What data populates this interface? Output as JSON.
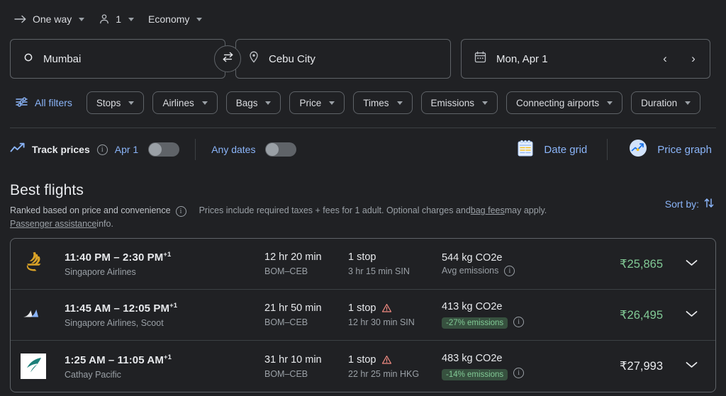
{
  "trip_options": {
    "trip_type": {
      "label": "One way",
      "icon": "arrow-right-icon"
    },
    "passengers": {
      "label": "1",
      "icon": "person-icon"
    },
    "cabin_class": {
      "label": "Economy"
    }
  },
  "search": {
    "origin": {
      "value": "Mumbai",
      "icon": "circle-icon"
    },
    "destination": {
      "value": "Cebu City",
      "icon": "location-pin-icon"
    },
    "swap_icon": "swap-arrows-icon",
    "date": {
      "value": "Mon, Apr 1",
      "icon": "calendar-icon"
    },
    "prev_label": "‹",
    "next_label": "›"
  },
  "filters": {
    "all_filters_label": "All filters",
    "all_filters_icon": "tune-sliders-icon",
    "chips": [
      {
        "label": "Stops"
      },
      {
        "label": "Airlines"
      },
      {
        "label": "Bags"
      },
      {
        "label": "Price"
      },
      {
        "label": "Times"
      },
      {
        "label": "Emissions"
      },
      {
        "label": "Connecting airports"
      },
      {
        "label": "Duration"
      }
    ]
  },
  "track": {
    "track_prices_label": "Track prices",
    "track_prices_icon": "trend-line-icon",
    "date_label": "Apr 1",
    "any_dates_label": "Any dates",
    "date_grid_label": "Date grid",
    "date_grid_icon": "calendar-grid-icon",
    "price_graph_label": "Price graph",
    "price_graph_icon": "price-graph-icon"
  },
  "best_flights": {
    "title": "Best flights",
    "ranked_text": "Ranked based on price and convenience",
    "prices_text_1": "Prices include required taxes + fees for 1 adult. Optional charges and ",
    "bag_fees_link": "bag fees",
    "prices_text_2": " may apply.",
    "passenger_assistance_link": "Passenger assistance",
    "passenger_assistance_suffix": " info.",
    "sort_by_label": "Sort by:",
    "sort_icon": "sort-arrows-icon"
  },
  "flights": [
    {
      "airline_logo": "singapore-airlines-logo",
      "times": "11:40 PM – 2:30 PM",
      "day_offset": "+1",
      "airline": "Singapore Airlines",
      "duration": "12 hr 20 min",
      "route": "BOM–CEB",
      "stops": "1 stop",
      "stop_detail": "3 hr 15 min SIN",
      "has_warning": false,
      "emissions": "544 kg CO2e",
      "emissions_note": "Avg emissions",
      "emissions_badge": "",
      "price": "₹25,865",
      "price_color": "green",
      "expand_icon": "chevron-down-icon"
    },
    {
      "airline_logo": "multi-airline-logo",
      "times": "11:45 AM – 12:05 PM",
      "day_offset": "+1",
      "airline": "Singapore Airlines, Scoot",
      "duration": "21 hr 50 min",
      "route": "BOM–CEB",
      "stops": "1 stop",
      "stop_detail": "12 hr 30 min SIN",
      "has_warning": true,
      "emissions": "413 kg CO2e",
      "emissions_note": "",
      "emissions_badge": "-27% emissions",
      "price": "₹26,495",
      "price_color": "green",
      "expand_icon": "chevron-down-icon"
    },
    {
      "airline_logo": "cathay-pacific-logo",
      "times": "1:25 AM – 11:05 AM",
      "day_offset": "+1",
      "airline": "Cathay Pacific",
      "duration": "31 hr 10 min",
      "route": "BOM–CEB",
      "stops": "1 stop",
      "stop_detail": "22 hr 25 min HKG",
      "has_warning": true,
      "emissions": "483 kg CO2e",
      "emissions_note": "",
      "emissions_badge": "-14% emissions",
      "price": "₹27,993",
      "price_color": "white",
      "expand_icon": "chevron-down-icon"
    }
  ],
  "colors": {
    "background": "#202124",
    "accent_blue": "#8ab4f8",
    "price_green": "#81c995",
    "badge_bg": "#37513f",
    "border": "#5f6368",
    "warning_red": "#f28b82"
  }
}
